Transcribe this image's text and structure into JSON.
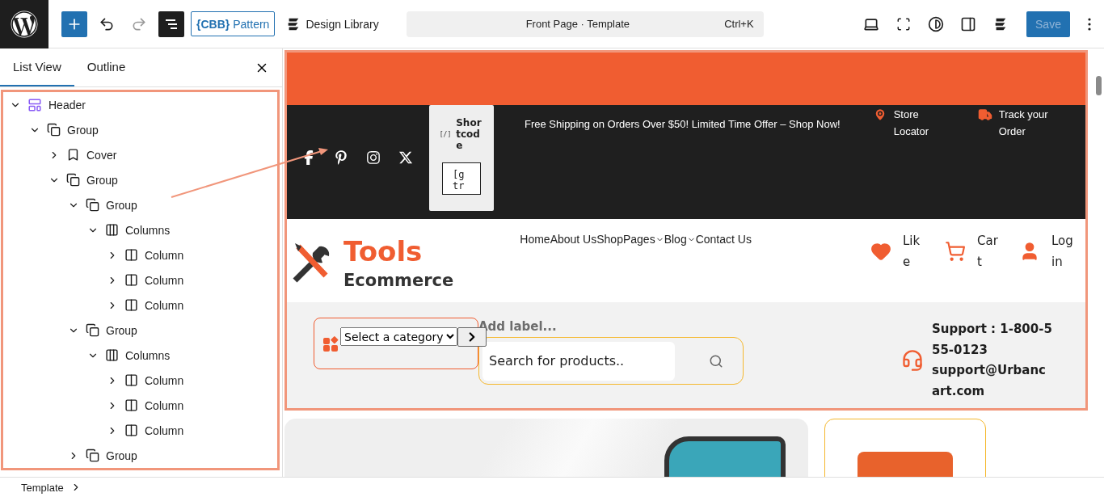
{
  "toolbar": {
    "list_view_active": true,
    "pattern_logo": "{CBB}",
    "pattern_label": "Pattern",
    "design_library": "Design Library",
    "command": {
      "title": "Front Page · Template",
      "shortcut": "Ctrl+K"
    },
    "save": {
      "label": "Save",
      "disabled": true
    }
  },
  "sidebar": {
    "tabs": [
      {
        "label": "List View",
        "selected": true
      },
      {
        "label": "Outline",
        "selected": false
      }
    ],
    "tree": [
      {
        "label": "Header",
        "kind": "header",
        "expanded": true,
        "children": [
          {
            "label": "Group",
            "kind": "group",
            "expanded": true,
            "children": [
              {
                "label": "Cover",
                "kind": "cover",
                "expanded": false
              },
              {
                "label": "Group",
                "kind": "group",
                "expanded": true,
                "children": [
                  {
                    "label": "Group",
                    "kind": "group",
                    "expanded": true,
                    "children": [
                      {
                        "label": "Columns",
                        "kind": "columns",
                        "expanded": true,
                        "children": [
                          {
                            "label": "Column",
                            "kind": "column",
                            "expanded": false
                          },
                          {
                            "label": "Column",
                            "kind": "column",
                            "expanded": false
                          },
                          {
                            "label": "Column",
                            "kind": "column",
                            "expanded": false
                          }
                        ]
                      }
                    ]
                  },
                  {
                    "label": "Group",
                    "kind": "group",
                    "expanded": true,
                    "children": [
                      {
                        "label": "Columns",
                        "kind": "columns",
                        "expanded": true,
                        "children": [
                          {
                            "label": "Column",
                            "kind": "column",
                            "expanded": false
                          },
                          {
                            "label": "Column",
                            "kind": "column",
                            "expanded": false
                          },
                          {
                            "label": "Column",
                            "kind": "column",
                            "expanded": false
                          }
                        ]
                      }
                    ]
                  },
                  {
                    "label": "Group",
                    "kind": "group",
                    "expanded": false
                  }
                ]
              }
            ]
          }
        ]
      }
    ]
  },
  "breadcrumb": "Template",
  "canvas": {
    "top_bar": {
      "shortcode": {
        "icon_text": "[/]",
        "title": "Shortcode",
        "value": "[gtr"
      },
      "announcement": "Free Shipping on Orders Over $50! Limited Time Offer – Shop Now!",
      "links": [
        {
          "label": "Store Locator",
          "kind": "pin"
        },
        {
          "label": "Track your Order",
          "kind": "truck"
        }
      ]
    },
    "header": {
      "logo": {
        "title": "Tools",
        "subtitle": "Ecommerce"
      },
      "nav": [
        {
          "label": "Home",
          "submenu": false
        },
        {
          "label": "About Us",
          "submenu": false
        },
        {
          "label": "Shop",
          "submenu": false
        },
        {
          "label": "Pages",
          "submenu": true
        },
        {
          "label": "Blog",
          "submenu": true
        },
        {
          "label": "Contact Us",
          "submenu": false
        }
      ],
      "actions": [
        {
          "label": "Like",
          "kind": "heart"
        },
        {
          "label": "Cart",
          "kind": "cart"
        },
        {
          "label": "Login",
          "kind": "user"
        }
      ]
    },
    "search_bar": {
      "category": "Select a category",
      "label": "Add label...",
      "placeholder": "Search for products..",
      "support": {
        "phone": "Support : 1-800-555-0123",
        "email": "support@Urbancart.com"
      }
    }
  }
}
